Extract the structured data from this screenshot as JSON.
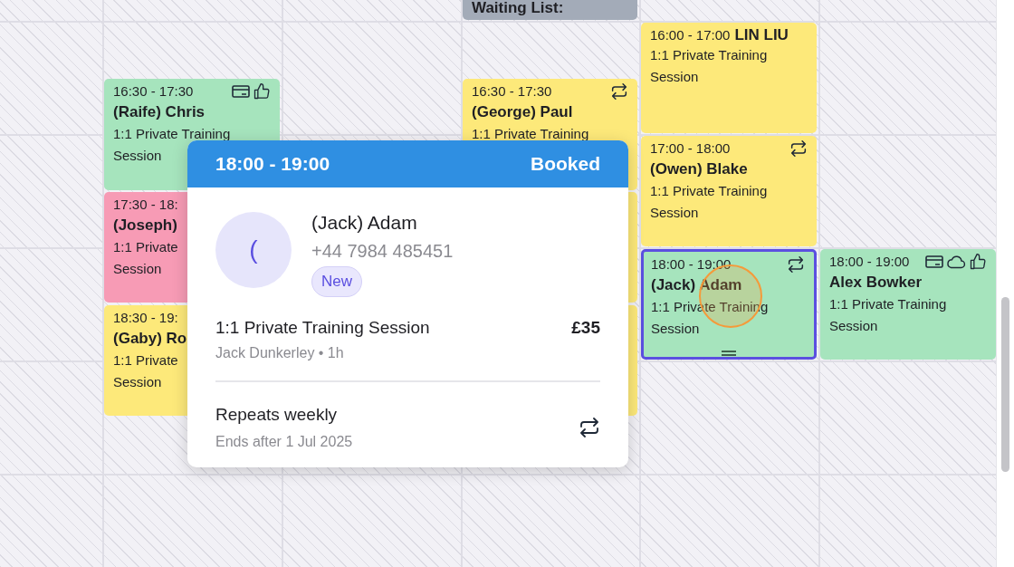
{
  "calendar": {
    "events": [
      {
        "kind": "waiting",
        "color": "#a3abb8",
        "title": "Waiting List:",
        "selected": false
      },
      {
        "kind": "booking",
        "color": "#a6e4bd",
        "time": "16:30 - 17:30",
        "name": "(Raife) Chris",
        "service": "1:1 Private Training",
        "service_2": "Session",
        "paid": true,
        "confirmed": true,
        "selected": false
      },
      {
        "kind": "booking",
        "color": "#f79bb5",
        "time": "17:30 - 18:",
        "name": "(Joseph)",
        "service": "1:1 Private",
        "service_2": "Session",
        "selected": false
      },
      {
        "kind": "booking",
        "color": "#fde97a",
        "time": "18:30 - 19:",
        "name": "(Gaby) Ro",
        "service": "1:1 Private",
        "service_2": "Session",
        "selected": false
      },
      {
        "kind": "booking",
        "color": "#fde97a",
        "time": "16:30 - 17:30",
        "name": "(George) Paul",
        "service": "1:1 Private Training",
        "recurring": true,
        "selected": false
      },
      {
        "kind": "hidden",
        "color": "#fde97a",
        "selected": false
      },
      {
        "kind": "hidden",
        "color": "#fde97a",
        "selected": false
      },
      {
        "kind": "inline",
        "color": "#fde97a",
        "time": "16:00 - 17:00",
        "name": "LIN LIU",
        "service": "1:1 Private Training",
        "service_2": "Session",
        "selected": false
      },
      {
        "kind": "booking",
        "color": "#fde97a",
        "time": "17:00 - 18:00",
        "name": "(Owen) Blake",
        "service": "1:1 Private Training",
        "service_2": "Session",
        "recurring": true,
        "selected": false
      },
      {
        "kind": "booking",
        "color": "#a6e4bd",
        "time": "18:00 - 19:00",
        "name": "(Jack) Adam",
        "service": "1:1 Private Training",
        "service_2": "Session",
        "recurring": true,
        "selected": true
      },
      {
        "kind": "booking",
        "color": "#a6e4bd",
        "time": "18:00 - 19:00",
        "name": "Alex Bowker",
        "service": "1:1 Private Training",
        "service_2": "Session",
        "paid": true,
        "online": true,
        "confirmed": true,
        "selected": false
      }
    ]
  },
  "popover": {
    "time": "18:00 - 19:00",
    "status": "Booked",
    "avatar": "(",
    "name": "(Jack) Adam",
    "phone": "+44 7984 485451",
    "badge": "New",
    "service": "1:1 Private Training Session",
    "price": "£35",
    "details": "Jack Dunkerley • 1h",
    "repeat": "Repeats weekly",
    "repeat_end": "Ends after 1 Jul 2025"
  }
}
